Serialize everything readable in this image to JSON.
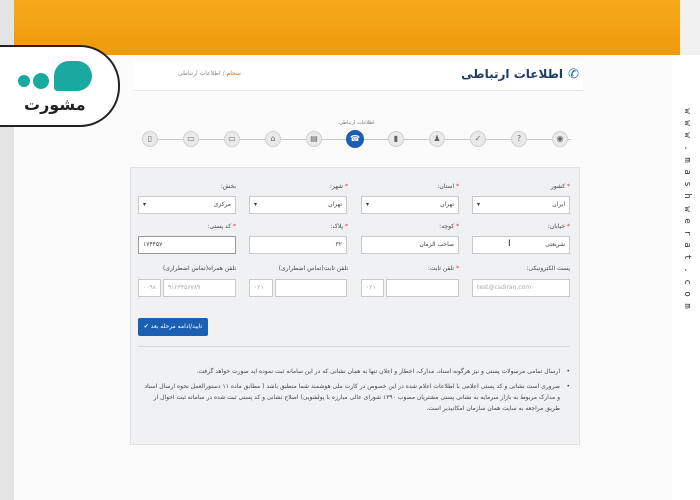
{
  "watermark": {
    "vertical_text": "www.mashwerat.com"
  },
  "logo": {
    "text": "مشورت"
  },
  "header": {
    "title": "اطلاعات ارتباطی",
    "breadcrumb_home": "سجام",
    "breadcrumb_sep": "/",
    "breadcrumb_current": "اطلاعات ارتباطی"
  },
  "steps": {
    "active_label": "اطلاعات ارتباطی",
    "items": [
      "help",
      "question",
      "person",
      "bookmark",
      "contact-active",
      "doc",
      "bank",
      "card",
      "doc2",
      "card2",
      "id"
    ]
  },
  "form": {
    "country_label": "کشور",
    "country_value": "ایران",
    "province_label": "استان:",
    "province_value": "تهران",
    "city_label": "شهر:",
    "city_value": "تهران",
    "district_label": "بخش:",
    "district_value": "مرکزی",
    "street_label": "خیابان:",
    "street_value": "شریعتی",
    "alley_label": "کوچه:",
    "alley_value": "صاحب الزمان",
    "plaque_label": "پلاک:",
    "plaque_value": "۳۲",
    "postal_label": "کد پستی:",
    "postal_value": "۱۷۴۴۵۷",
    "email_label": "پست الکترونیکی:",
    "email_placeholder": "test@csdiran.com",
    "phone_label": "تلفن ثابت:",
    "phone_prefix": "۰۲۱",
    "emergency_phone_label": "تلفن ثابت(تماس اضطراری)",
    "emergency_phone_prefix": "۰۲۱",
    "mobile_label": "تلفن همراه(تماس اضطراری)",
    "mobile_value": "۹۱۲۳۴۵۶۷۸۹",
    "mobile_prefix": "۰۰۹۸"
  },
  "submit": {
    "label": "✔ تایید/ادامه مرحله بعد"
  },
  "notes": [
    "ارسال تمامی مرسولات پستی و نیز هرگونه اسناد، مدارک، اخطار و اعلان تنها به همان نشانی که در این سامانه ثبت نموده اید صورت خواهد گرفت.",
    "ضروری است نشانی و کد پستی اعلامی با اطلاعات اعلام شده در این خصوص در کارت ملی هوشمند شما منطبق باشد ( مطابق ماده ۱۱ دستورالعمل نحوه ارسال اسناد و مدارک مربوط به بازار سرمایه به نشانی پستی مشتریان مصوب ۱۳۹۰ شورای عالی مبارزه با پولشویی) اصلاح نشانی و کد پستی ثبت شده در سامانه ثبت احوال از طریق مراجعه به سایت همان سازمان امکانپذیر است."
  ],
  "colors": {
    "accent": "#1b5fb3",
    "orange": "#f0a010",
    "teal": "#1aa9a0"
  }
}
